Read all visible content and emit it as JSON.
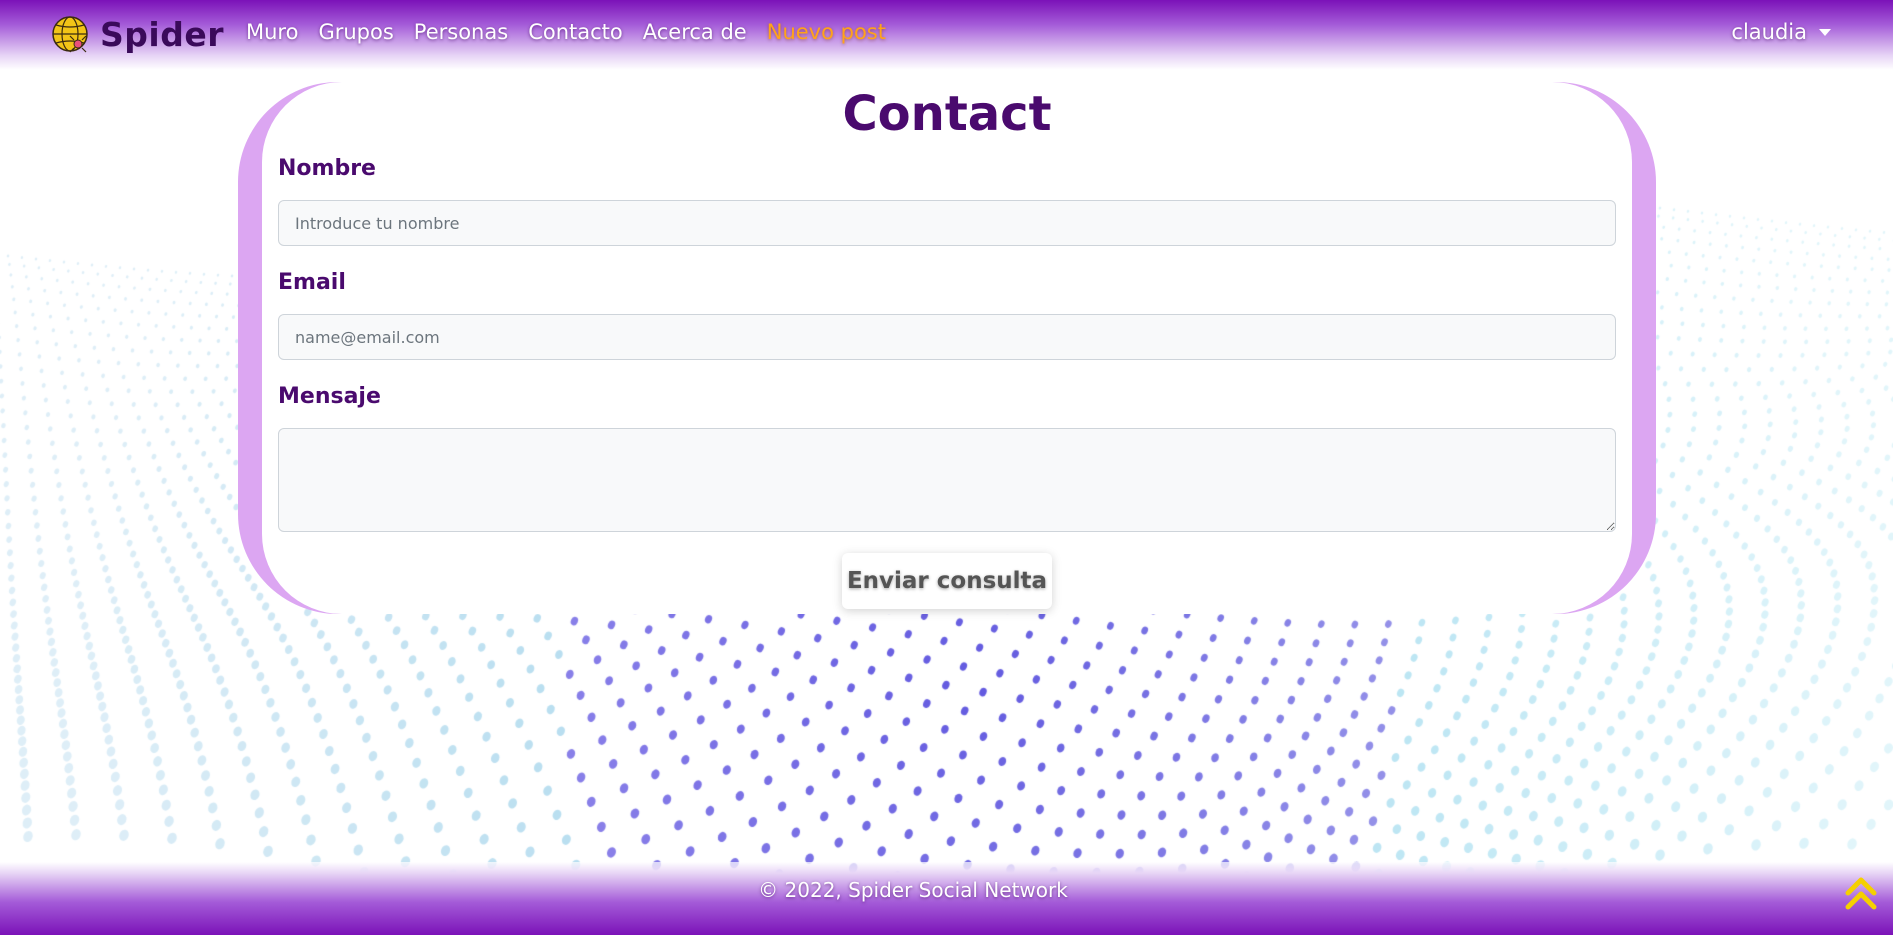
{
  "colors": {
    "brand_dark": "#4a0a6e",
    "nav_gradient_top": "#7b12b8",
    "card_border": "#dca6f2",
    "highlight": "#ffa31a",
    "scroll_icon": "#f5d000"
  },
  "navbar": {
    "brand_name": "Spider",
    "brand_icon": "globe-spider-logo-icon",
    "links": [
      {
        "label": "Muro"
      },
      {
        "label": "Grupos"
      },
      {
        "label": "Personas"
      },
      {
        "label": "Contacto"
      },
      {
        "label": "Acerca de"
      },
      {
        "label": "Nuevo post"
      }
    ],
    "user": {
      "name": "claudia",
      "icon": "caret-down-icon"
    }
  },
  "form": {
    "title": "Contact",
    "name_label": "Nombre",
    "name_placeholder": "Introduce tu nombre",
    "name_value": "",
    "email_label": "Email",
    "email_placeholder": "name@email.com",
    "email_value": "",
    "message_label": "Mensaje",
    "message_value": "",
    "submit_label": "Enviar consulta"
  },
  "footer": {
    "text": "© 2022, Spider Social Network",
    "scroll_icon": "double-chevron-up-icon"
  }
}
